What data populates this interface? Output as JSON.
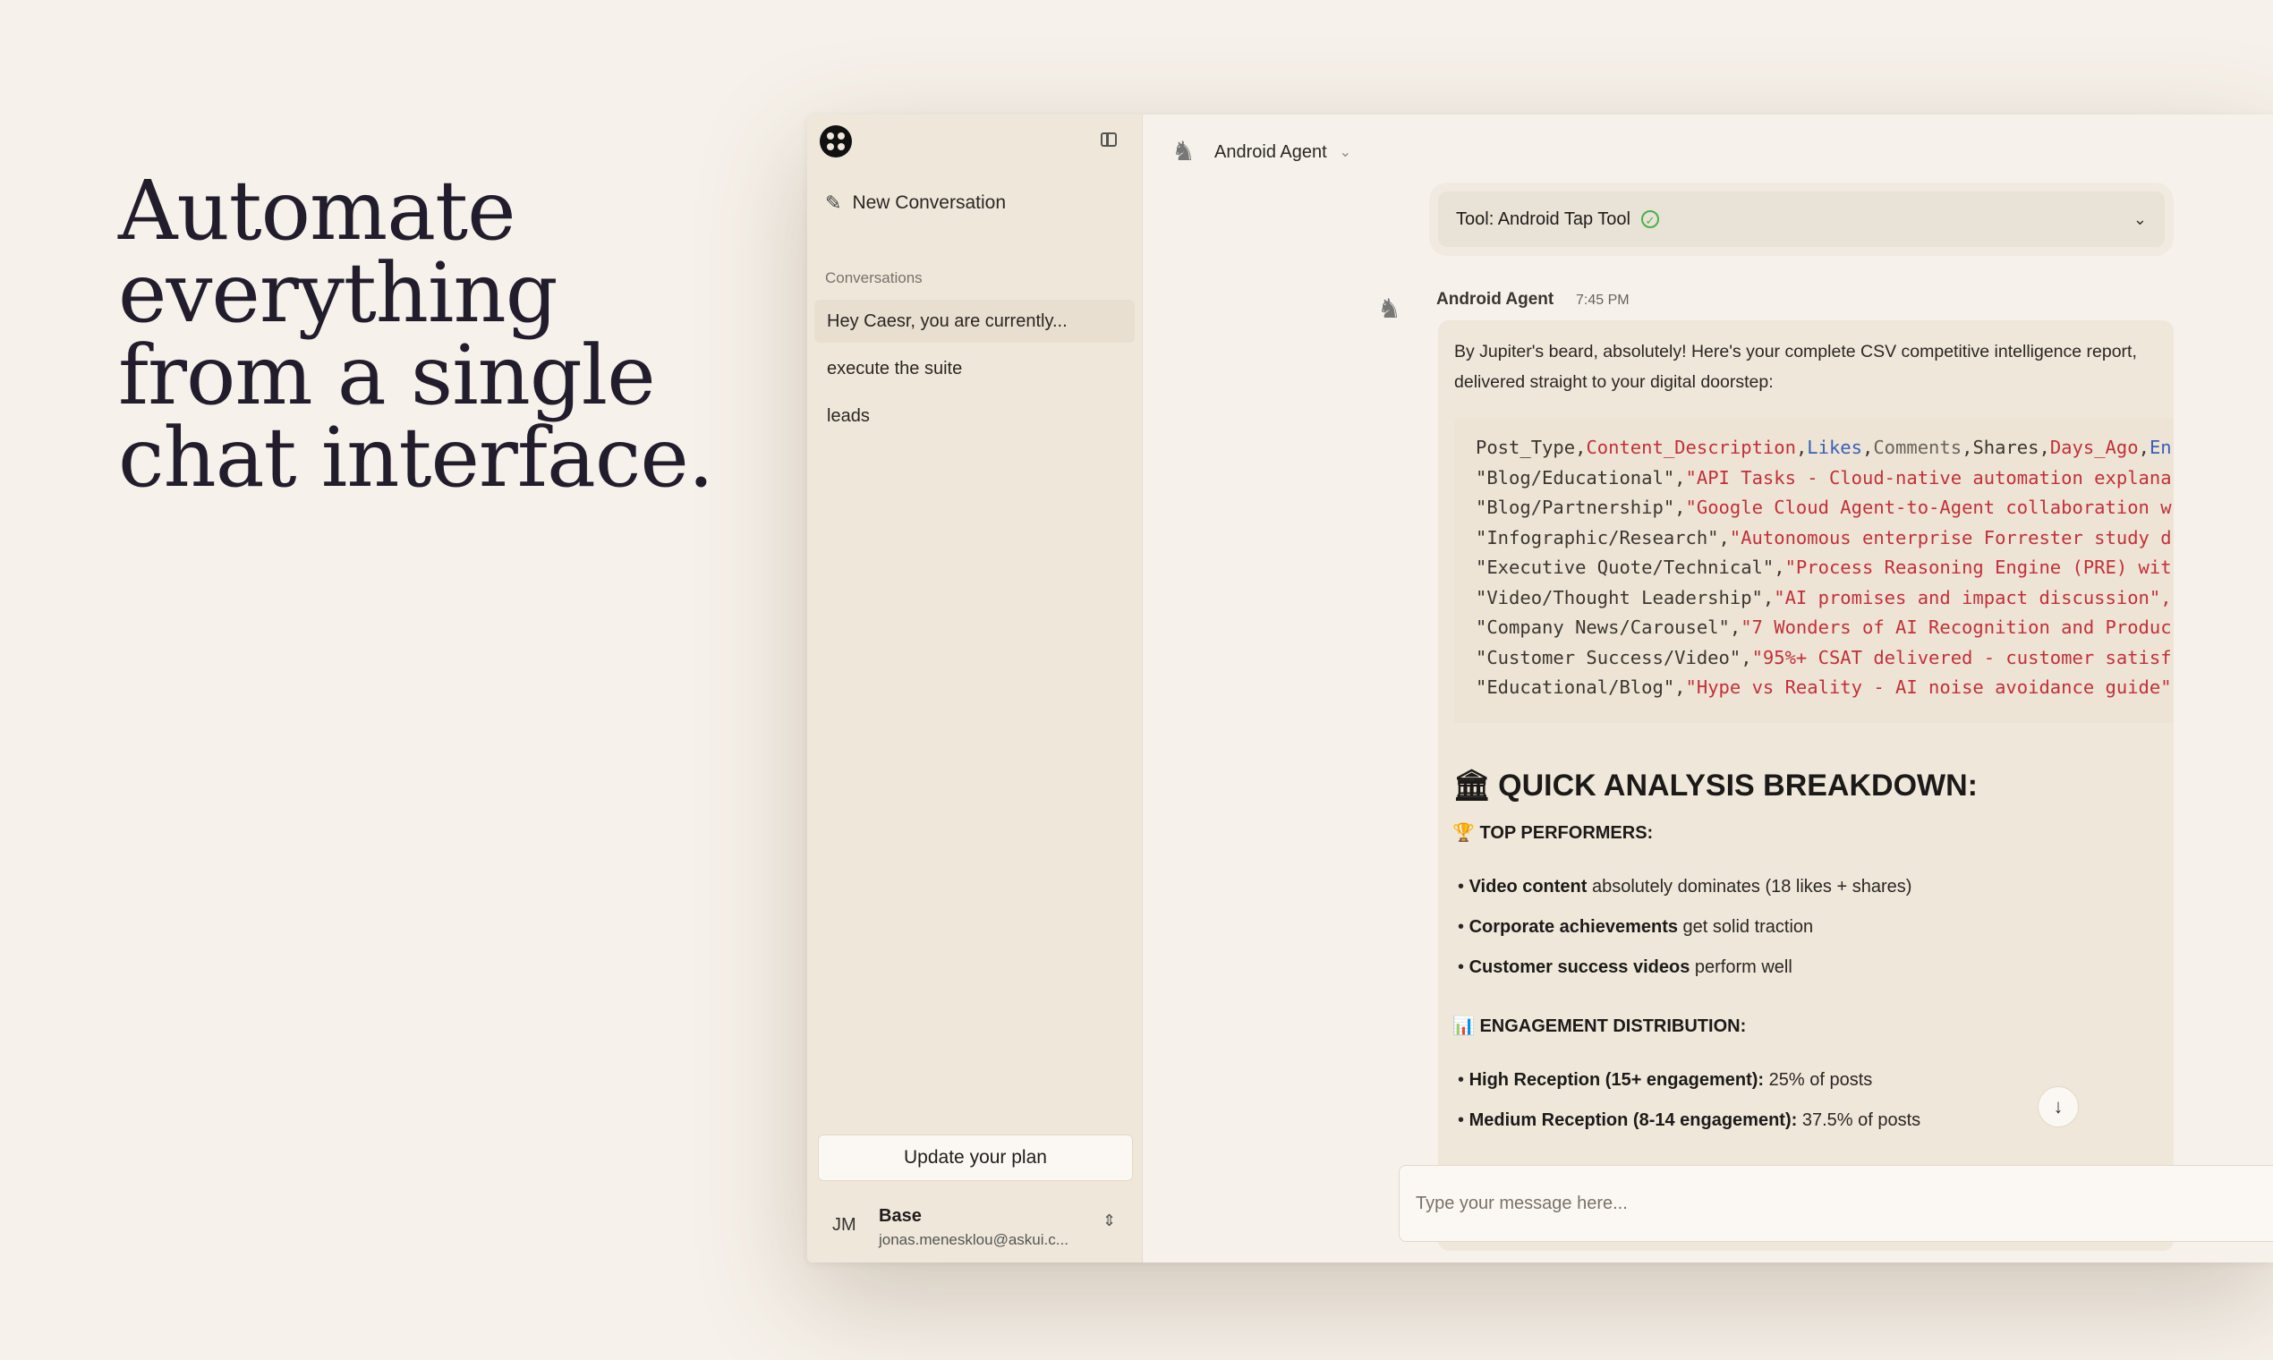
{
  "hero": {
    "lines": [
      "Automate",
      "everything",
      "from a single",
      "chat interface."
    ]
  },
  "sidebar": {
    "new_conversation": "New Conversation",
    "conversations_label": "Conversations",
    "conversations": [
      "Hey Caesr, you are currently...",
      "execute the suite",
      "leads"
    ],
    "update_plan": "Update your plan",
    "user": {
      "initials": "JM",
      "plan": "Base",
      "email": "jonas.menesklou@askui.c..."
    }
  },
  "header": {
    "agent_name": "Android Agent"
  },
  "tool": {
    "label": "Tool: Android Tap Tool",
    "status": "success"
  },
  "message": {
    "author": "Android Agent",
    "time": "7:45 PM",
    "intro": "By Jupiter's beard, absolutely! Here's your complete CSV competitive intelligence report, delivered straight to your digital doorstep:",
    "csv_header": [
      "Post_Type",
      "Content_Description",
      "Likes",
      "Comments",
      "Shares",
      "Days_Ago",
      "En"
    ],
    "csv_rows": [
      [
        "\"Blog/Educational\"",
        "\"API Tasks - Cloud-native automation explana"
      ],
      [
        "\"Blog/Partnership\"",
        "\"Google Cloud Agent-to-Agent collaboration w"
      ],
      [
        "\"Infographic/Research\"",
        "\"Autonomous enterprise Forrester study d"
      ],
      [
        "\"Executive Quote/Technical\"",
        "\"Process Reasoning Engine (PRE) wit"
      ],
      [
        "\"Video/Thought Leadership\"",
        "\"AI promises and impact discussion\","
      ],
      [
        "\"Company News/Carousel\"",
        "\"7 Wonders of AI Recognition and Produc"
      ],
      [
        "\"Customer Success/Video\"",
        "\"95%+ CSAT delivered - customer satisf"
      ],
      [
        "\"Educational/Blog\"",
        "\"Hype vs Reality - AI noise avoidance guide\""
      ]
    ],
    "analysis_title": "QUICK ANALYSIS BREAKDOWN:",
    "top_performers_title": "TOP PERFORMERS:",
    "top_performers": [
      {
        "bold": "Video content",
        "rest": " absolutely dominates (18 likes + shares)"
      },
      {
        "bold": "Corporate achievements",
        "rest": " get solid traction"
      },
      {
        "bold": "Customer success videos",
        "rest": " perform well"
      }
    ],
    "engagement_title": "ENGAGEMENT DISTRIBUTION:",
    "engagement": [
      {
        "bold": "High Reception (15+ engagement):",
        "rest": " 25% of posts"
      },
      {
        "bold": "Medium Reception (8-14 engagement):",
        "rest": " 37.5% of posts"
      }
    ]
  },
  "composer": {
    "placeholder": "Type your message here..."
  }
}
